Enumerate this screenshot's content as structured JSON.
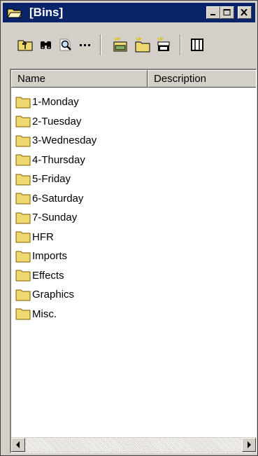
{
  "window": {
    "title": "[Bins]"
  },
  "toolbar": {
    "tools": [
      {
        "icon": "folder-up-icon"
      },
      {
        "icon": "binoculars-find-icon"
      },
      {
        "icon": "magnifier-icon"
      },
      {
        "icon": "ellipsis-icon"
      },
      {
        "icon": "new-bin-icon"
      },
      {
        "icon": "new-folder-icon"
      },
      {
        "icon": "clapper-icon"
      },
      {
        "icon": "column-view-icon"
      }
    ]
  },
  "list": {
    "columns": [
      {
        "label": "Name"
      },
      {
        "label": "Description"
      }
    ],
    "items": [
      {
        "name": "1-Monday"
      },
      {
        "name": "2-Tuesday"
      },
      {
        "name": "3-Wednesday"
      },
      {
        "name": "4-Thursday"
      },
      {
        "name": "5-Friday"
      },
      {
        "name": "6-Saturday"
      },
      {
        "name": "7-Sunday"
      },
      {
        "name": "HFR"
      },
      {
        "name": "Imports"
      },
      {
        "name": "Effects"
      },
      {
        "name": "Graphics"
      },
      {
        "name": "Misc."
      }
    ]
  },
  "colors": {
    "titlebar": "#0a246a",
    "face": "#d4d0c8",
    "folder": "#f0d870"
  }
}
